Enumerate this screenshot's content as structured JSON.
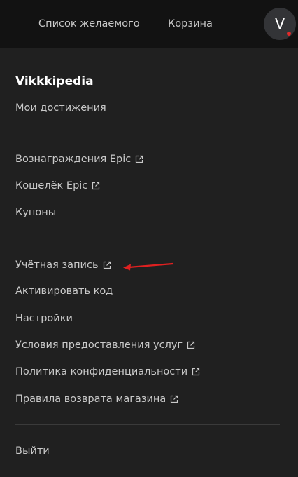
{
  "header": {
    "wishlist_label": "Список желаемого",
    "cart_label": "Корзина",
    "avatar_letter": "V"
  },
  "menu": {
    "username": "Vikkkipedia",
    "achievements": "Мои достижения",
    "rewards": "Вознаграждения Epic",
    "wallet": "Кошелёк Epic",
    "coupons": "Купоны",
    "account": "Учётная запись",
    "redeem": "Активировать код",
    "settings": "Настройки",
    "terms": "Условия предоставления услуг",
    "privacy": "Политика конфиденциальности",
    "refund": "Правила возврата магазина",
    "logout": "Выйти"
  },
  "colors": {
    "background": "#121212",
    "menu_background": "#202020",
    "text": "#c9c9c9",
    "annotation_arrow": "#e02020",
    "notification_dot": "#e22a2a"
  },
  "icons": {
    "external_link": "external-link-icon"
  }
}
